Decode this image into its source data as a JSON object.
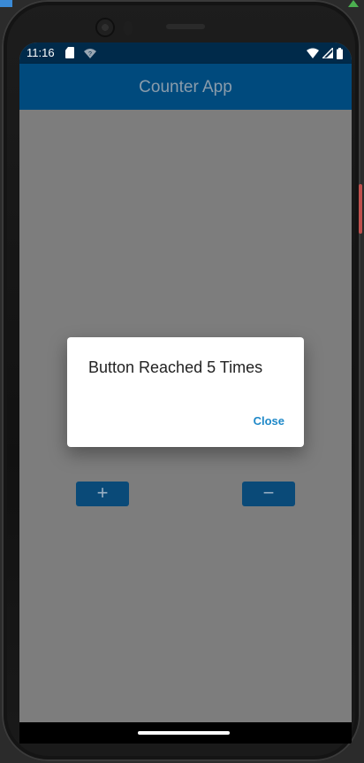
{
  "statusbar": {
    "time": "11:16",
    "icons": [
      "sd-card-icon",
      "wifi-question-icon",
      "wifi-icon",
      "signal-icon",
      "battery-icon"
    ]
  },
  "appbar": {
    "title": "Counter App"
  },
  "buttons": {
    "increment_label": "+",
    "decrement_label": "−"
  },
  "dialog": {
    "message": "Button Reached 5 Times",
    "close_label": "Close"
  },
  "colors": {
    "appbar": "#004a7d",
    "statusbar": "#002a4a",
    "scrim_bg": "#7d7d7d",
    "accent": "#1e88c8"
  }
}
